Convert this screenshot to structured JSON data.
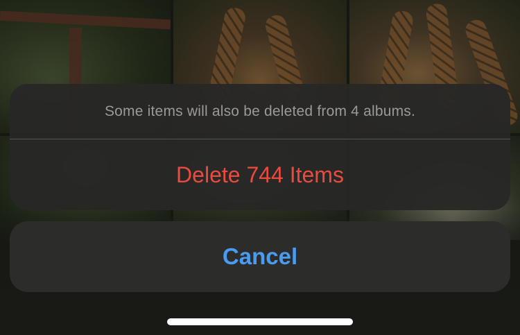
{
  "action_sheet": {
    "message": "Some items will also be deleted from 4 albums.",
    "delete_label": "Delete 744 Items",
    "cancel_label": "Cancel"
  },
  "colors": {
    "destructive": "#eb4b3f",
    "cancel": "#4a9cf3",
    "message": "#9a9a98",
    "sheet_background": "#282826"
  }
}
